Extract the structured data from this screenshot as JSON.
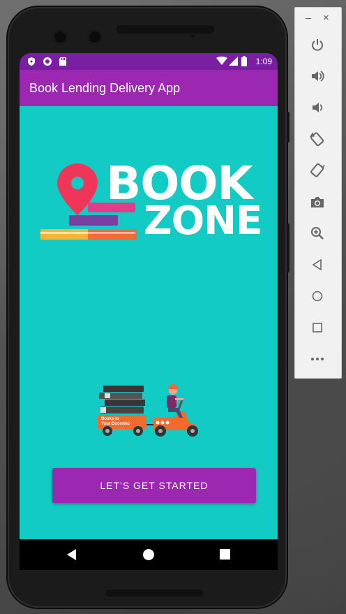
{
  "status_bar": {
    "time": "1:09"
  },
  "app_bar": {
    "title": "Book Lending Delivery App"
  },
  "logo": {
    "line1": "BOOK",
    "line2": "ZONE"
  },
  "illustration": {
    "cart_text_1": "Books to",
    "cart_text_2": "Your Doorstep"
  },
  "cta": {
    "label": "LET'S GET STARTED"
  },
  "colors": {
    "status_bar": "#7b1fa2",
    "app_bar": "#9c27b0",
    "background": "#12cbc4",
    "button": "#9c27b0",
    "pin": "#f0355a"
  },
  "emulator_panel": {
    "minimize": "–",
    "close": "×",
    "buttons": [
      "power-icon",
      "volume-up-icon",
      "volume-down-icon",
      "rotate-left-icon",
      "rotate-right-icon",
      "camera-icon",
      "zoom-icon",
      "back-icon",
      "home-icon",
      "overview-icon",
      "more-icon"
    ]
  }
}
